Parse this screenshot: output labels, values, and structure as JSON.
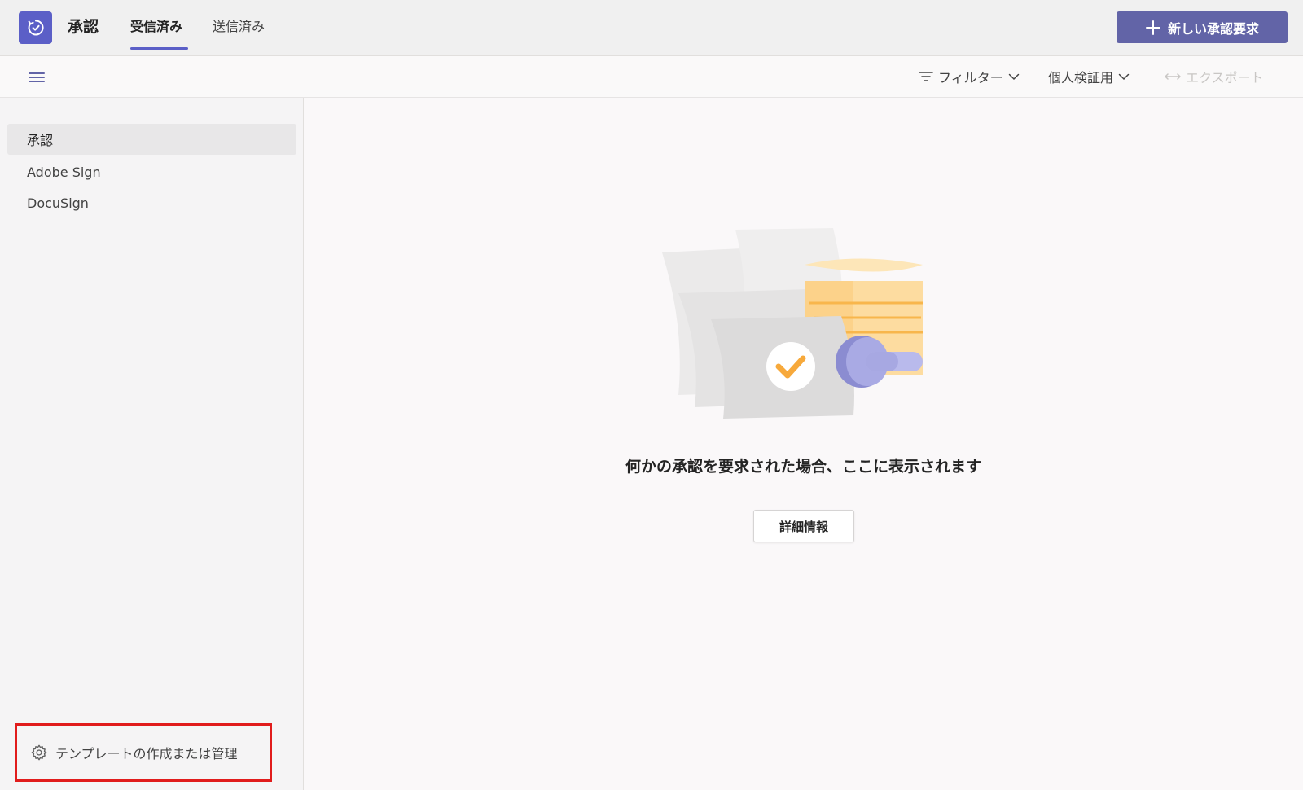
{
  "app": {
    "title": "承認",
    "logo_icon": "approvals-icon",
    "accent_color": "#6264a7"
  },
  "tabs": [
    {
      "label": "受信済み",
      "active": true
    },
    {
      "label": "送信済み",
      "active": false
    }
  ],
  "header": {
    "new_request_label": "新しい承認要求"
  },
  "toolbar": {
    "filter_label": "フィルター",
    "personal_label": "個人検証用",
    "export_label": "エクスポート"
  },
  "sidebar": {
    "items": [
      {
        "label": "承認",
        "selected": true
      },
      {
        "label": "Adobe Sign",
        "selected": false
      },
      {
        "label": "DocuSign",
        "selected": false
      }
    ],
    "template_link_label": "テンプレートの作成または管理"
  },
  "main": {
    "empty_message": "何かの承認を要求された場合、ここに表示されます",
    "details_button_label": "詳細情報"
  }
}
